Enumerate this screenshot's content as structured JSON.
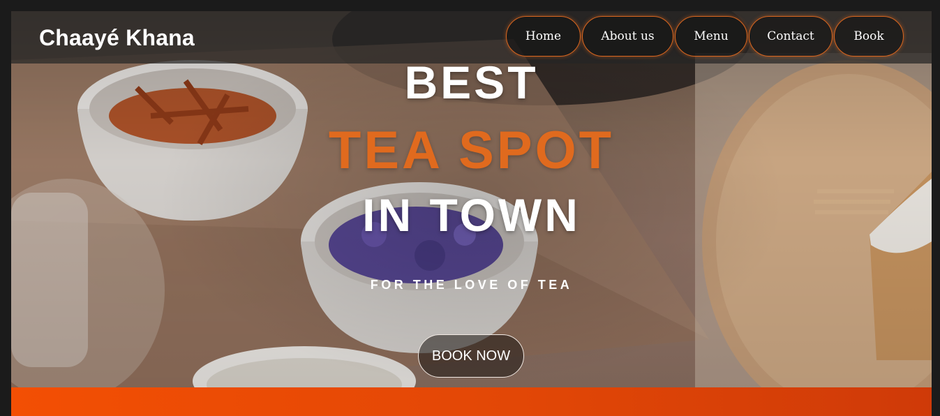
{
  "brand": {
    "name": "Chaayé Khana"
  },
  "nav": {
    "home": "Home",
    "about": "About us",
    "menu": "Menu",
    "contact": "Contact",
    "book": "Book"
  },
  "hero": {
    "line1": "BEST",
    "line2": "TEA SPOT",
    "line3": "IN TOWN",
    "tagline": "FOR THE LOVE OF TEA",
    "cta": "BOOK NOW"
  },
  "colors": {
    "accent": "#e06a1e",
    "band": "#f34f04",
    "navbar": "#262626"
  }
}
